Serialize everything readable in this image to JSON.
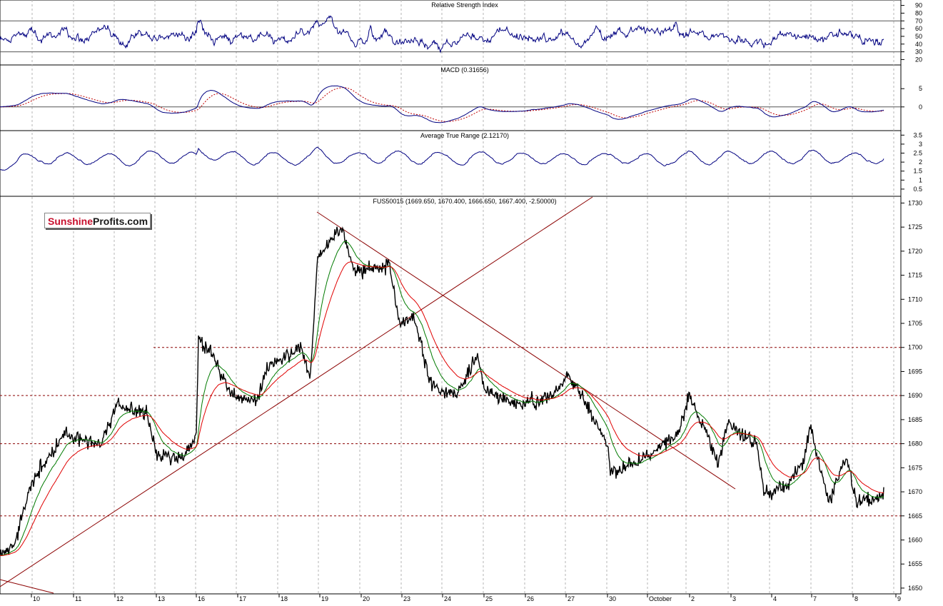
{
  "panels": {
    "rsi": {
      "title": "Relative Strength Index",
      "ticks": [
        90,
        80,
        70,
        60,
        50,
        40,
        30,
        20
      ],
      "range": [
        13,
        97
      ],
      "levels": [
        70,
        30
      ]
    },
    "macd": {
      "title": "MACD (0.31656)",
      "ticks": [
        5,
        0
      ],
      "range": [
        -6.5,
        11.5
      ]
    },
    "atr": {
      "title": "Average True Range (2.12170)",
      "ticks": [
        3.5,
        3.0,
        2.5,
        2.0,
        1.5,
        1.0,
        0.5
      ],
      "range": [
        0.1,
        3.75
      ]
    },
    "price": {
      "title": "FUS50015 (1669.650, 1670.400, 1666.650, 1667.400, -2.50000)",
      "ticks": [
        1730,
        1725,
        1720,
        1715,
        1710,
        1705,
        1700,
        1695,
        1690,
        1685,
        1680,
        1675,
        1670,
        1665,
        1660,
        1655,
        1650
      ],
      "range": [
        1648.8,
        1731.4
      ]
    }
  },
  "logo": {
    "part1": "Sunshine",
    "part2": "Profits.com"
  },
  "x_axis": {
    "labels": [
      "10",
      "11",
      "12",
      "13",
      "16",
      "17",
      "18",
      "19",
      "20",
      "23",
      "24",
      "25",
      "26",
      "27",
      "30",
      "October",
      "2",
      "3",
      "4",
      "7",
      "8",
      "9"
    ]
  },
  "chart_data": {
    "type": "line",
    "title": "FUS50015 (1669.650, 1670.400, 1666.650, 1667.400, -2.50000)",
    "x": [
      "10",
      "11",
      "12",
      "13",
      "16",
      "17",
      "18",
      "19",
      "20",
      "23",
      "24",
      "25",
      "26",
      "27",
      "30",
      "October",
      "2",
      "3",
      "4",
      "7",
      "8"
    ],
    "series": [
      {
        "values": [
          1657,
          1681,
          1688,
          1678,
          1699,
          1689,
          1699,
          1720,
          1716,
          1706,
          1691,
          1691,
          1688,
          1692,
          1673,
          1680,
          1688,
          1680,
          1670,
          1681,
          1668
        ]
      }
    ],
    "ylim": [
      1650,
      1730
    ],
    "horizontal_levels": [
      1700,
      1690,
      1680,
      1665
    ],
    "colors": {
      "price": "#000000",
      "ma_fast": "#007a00",
      "ma_slow": "#e00000",
      "indicator": "#000080",
      "trendline": "#8b0000",
      "level": "#8b0000",
      "grid": "#b4b4b4"
    }
  }
}
